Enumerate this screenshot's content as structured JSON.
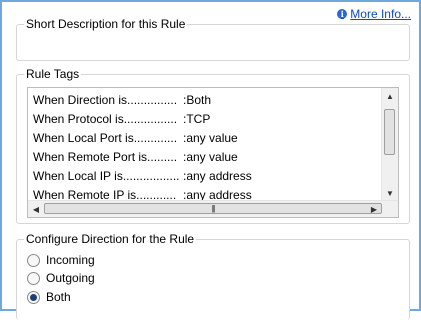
{
  "header": {
    "more_info_label": "More Info..."
  },
  "short_description": {
    "title": "Short Description for this Rule"
  },
  "rule_tags": {
    "title": "Rule Tags",
    "rows": [
      {
        "key": "When Direction is...............",
        "value": ":Both"
      },
      {
        "key": "When Protocol is................",
        "value": ":TCP"
      },
      {
        "key": "When Local Port is.............",
        "value": ":any value"
      },
      {
        "key": "When Remote Port is.........",
        "value": ":any value"
      },
      {
        "key": "When Local IP is.................",
        "value": ":any address"
      },
      {
        "key": "When Remote IP is............",
        "value": ":any address"
      }
    ]
  },
  "direction": {
    "title": "Configure Direction for the Rule",
    "options": [
      {
        "label": "Incoming",
        "checked": false
      },
      {
        "label": "Outgoing",
        "checked": false
      },
      {
        "label": "Both",
        "checked": true
      }
    ]
  },
  "colors": {
    "frame_border": "#6fa8dc",
    "link": "#0b4cc3"
  }
}
